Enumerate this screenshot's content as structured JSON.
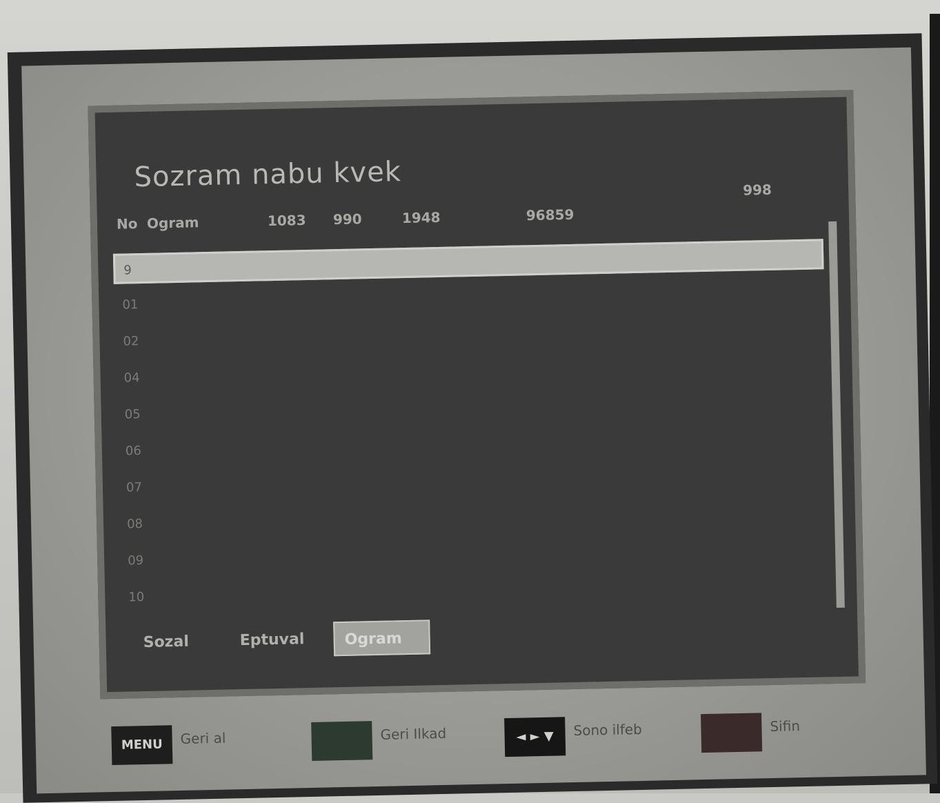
{
  "osd": {
    "title": "Sozram nabu kvek",
    "columns": {
      "no": "No",
      "name": "Ogram",
      "c1": "1083",
      "c2": "990",
      "c3": "1948",
      "c4": "96859",
      "c5": "998"
    },
    "rows": [
      "9",
      "01",
      "02",
      "04",
      "05",
      "06",
      "07",
      "08",
      "09",
      "10"
    ],
    "selected_row_index": 0,
    "buttons": {
      "b1": "Sozal",
      "b2": "Eptuval",
      "b3": "Ogram"
    }
  },
  "legend": [
    {
      "key": "MENU",
      "label": "Geri al"
    },
    {
      "key": "",
      "label": "Geri Ilkad"
    },
    {
      "key": "◄ ► ▼",
      "label": "Sono ilfeb"
    },
    {
      "key": "",
      "label": "Sifin"
    }
  ],
  "colors": {
    "osd_bg": "#3a3a3a",
    "selected_row": "#b6b6b2",
    "screen_surround": "#9a9a96"
  }
}
